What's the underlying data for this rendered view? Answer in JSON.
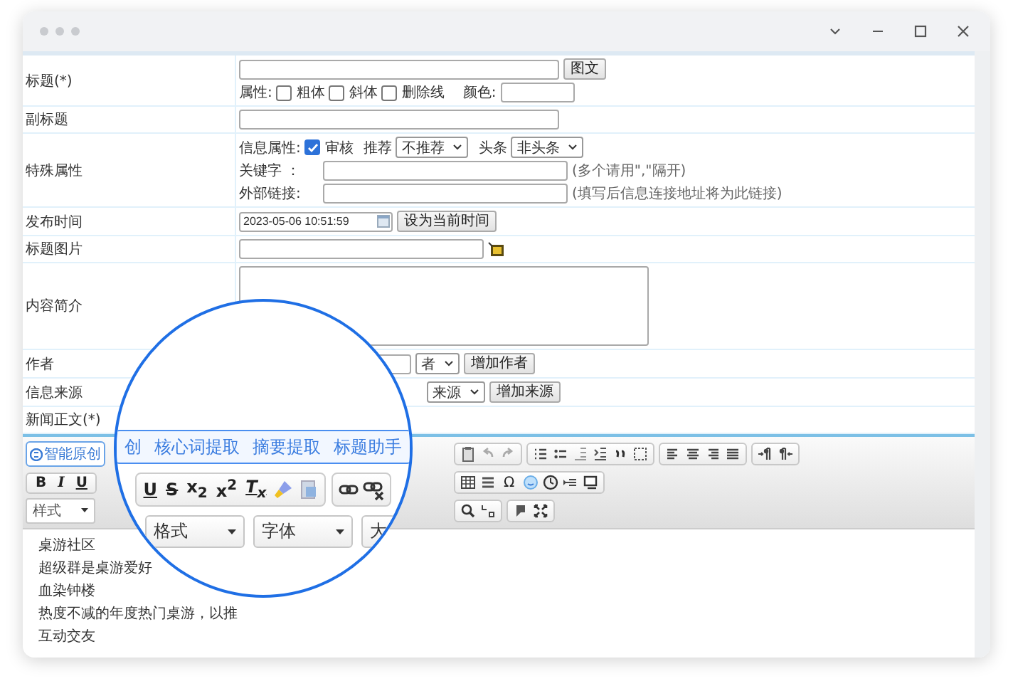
{
  "title_row": {
    "label": "标题(*)",
    "button": "图文",
    "attributes_label": "属性:",
    "styles": [
      {
        "label": "粗体",
        "checked": false
      },
      {
        "label": "斜体",
        "checked": false
      },
      {
        "label": "删除线",
        "checked": false
      }
    ],
    "color_label": "颜色:"
  },
  "subtitle_row": {
    "label": "副标题"
  },
  "special_row": {
    "label": "特殊属性",
    "info_label": "信息属性:",
    "review": {
      "label": "审核",
      "checked": true
    },
    "recommend": {
      "label": "推荐",
      "value": "不推荐"
    },
    "headline": {
      "label": "头条",
      "value": "非头条"
    },
    "keywords": {
      "label": "关键字 ：",
      "hint": "(多个请用\",\"隔开)"
    },
    "external_link": {
      "label": "外部链接:",
      "hint": "(填写后信息连接地址将为此链接)"
    }
  },
  "publish_row": {
    "label": "发布时间",
    "value": "2023-05-06 10:51:59",
    "button": "设为当前时间"
  },
  "image_row": {
    "label": "标题图片"
  },
  "summary_row": {
    "label": "内容简介"
  },
  "author_row": {
    "label": "作者",
    "select_value": "者",
    "button": "增加作者"
  },
  "source_row": {
    "label": "信息来源",
    "select_value": "来源",
    "button": "增加来源"
  },
  "body_label": "新闻正文(*)",
  "editor": {
    "smart_button": "智能原创",
    "format_buttons": [
      "B",
      "I",
      "U"
    ],
    "special_char": "Ω",
    "style_select": "样式",
    "content": [
      "桌游社区",
      "超级群是桌游爱好",
      "血染钟楼",
      "热度不减的年度热门桌游，以推",
      "互动交友"
    ]
  },
  "magnifier": {
    "tabs": [
      "创",
      "核心词提取",
      "摘要提取",
      "标题助手"
    ],
    "format_buttons": [
      "U",
      "S",
      "x$_{2}$",
      "x$^{2}$",
      "T$_{x}$"
    ],
    "selects": [
      "格式",
      "字体"
    ],
    "cut_label": "大"
  }
}
